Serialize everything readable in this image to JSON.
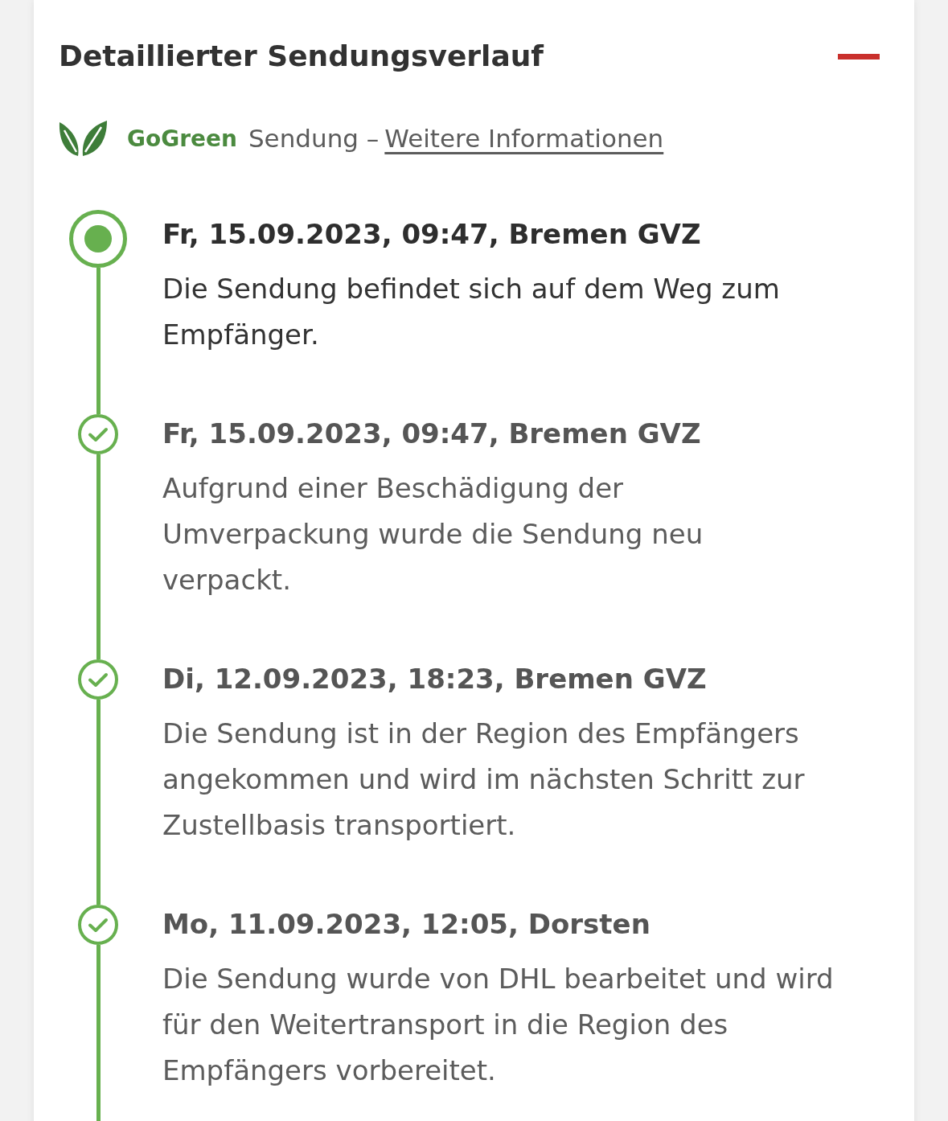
{
  "section": {
    "title": "Detaillierter Sendungsverlauf",
    "expanded": true
  },
  "gogreen": {
    "brand": "GoGreen",
    "text": "Sendung –",
    "link": "Weitere Informationen"
  },
  "events": [
    {
      "kind": "current",
      "heading": "Fr, 15.09.2023, 09:47, Bremen GVZ",
      "description": "Die Sendung befindet sich auf dem Weg zum Empfänger."
    },
    {
      "kind": "done",
      "heading": "Fr, 15.09.2023, 09:47, Bremen GVZ",
      "description": "Aufgrund einer Beschädigung der Umverpackung wurde die Sendung neu verpackt."
    },
    {
      "kind": "done",
      "heading": "Di, 12.09.2023, 18:23, Bremen GVZ",
      "description": "Die Sendung ist in der Region des Empfängers angekommen und wird im nächsten Schritt zur Zustellbasis transportiert."
    },
    {
      "kind": "done",
      "heading": "Mo, 11.09.2023, 12:05, Dorsten",
      "description": "Die Sendung wurde von DHL bearbeitet und wird für den Weitertransport in die Region des Empfängers vorbereitet."
    }
  ]
}
